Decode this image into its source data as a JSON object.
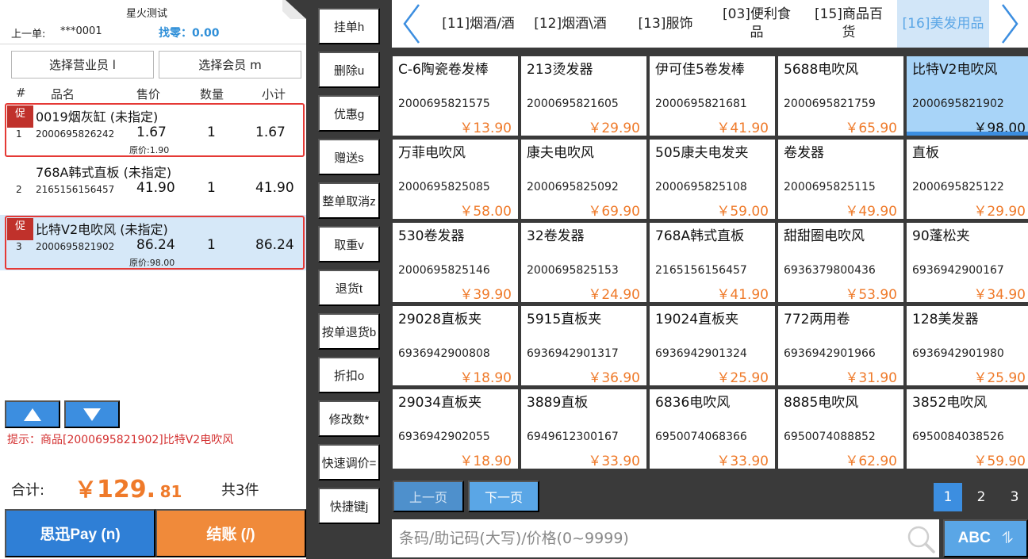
{
  "header": {
    "store_name": "星火测试",
    "last_order_label": "上一单:",
    "last_order_value": "***0001",
    "change_text": "找零：0.00"
  },
  "buttons": {
    "select_clerk": "选择营业员 l",
    "select_member": "选择会员 m"
  },
  "cart": {
    "columns": [
      "#",
      "品名",
      "售价",
      "数量",
      "小计"
    ],
    "promo_label": "促",
    "items": [
      {
        "idx": "1",
        "name": "0019烟灰缸 (未指定)",
        "code": "2000695826242",
        "price": "1.67",
        "qty": "1",
        "subtotal": "1.67",
        "original": "原价:1.90",
        "promo": true
      },
      {
        "idx": "2",
        "name": "768A韩式直板 (未指定)",
        "code": "2165156156457",
        "price": "41.90",
        "qty": "1",
        "subtotal": "41.90",
        "original": "",
        "promo": false
      },
      {
        "idx": "3",
        "name": "比特V2电吹风 (未指定)",
        "code": "2000695821902",
        "price": "86.24",
        "qty": "1",
        "subtotal": "86.24",
        "original": "原价:98.00",
        "promo": true
      }
    ]
  },
  "hint": "提示：商品[2000695821902]比特V2电吹风",
  "total": {
    "label": "合计:",
    "currency": "￥",
    "integer": "129.",
    "decimal": "81",
    "count": "共3件"
  },
  "pay": {
    "sixun": "思迅Pay (n)",
    "checkout": "结账 (/)"
  },
  "toolbar": [
    "挂单h",
    "删除u",
    "优惠g",
    "赠送s",
    "整单取消z",
    "取重v",
    "退货t",
    "按单退货b",
    "折扣o",
    "修改数*",
    "快速调价=",
    "快捷键j"
  ],
  "categories": [
    {
      "label": "[11]烟酒/酒",
      "active": false
    },
    {
      "label": "[12]烟酒\\酒",
      "active": false
    },
    {
      "label": "[13]服饰",
      "active": false
    },
    {
      "label": "[03]便利食品",
      "active": false
    },
    {
      "label": "[15]商品百货",
      "active": false
    },
    {
      "label": "[16]美发用品",
      "active": true
    }
  ],
  "products": [
    {
      "name": "C-6陶瓷卷发棒",
      "code": "2000695821575",
      "price": "￥13.90"
    },
    {
      "name": "213烫发器",
      "code": "2000695821605",
      "price": "￥29.90"
    },
    {
      "name": "伊可佳5卷发棒",
      "code": "2000695821681",
      "price": "￥41.90"
    },
    {
      "name": "5688电吹风",
      "code": "2000695821759",
      "price": "￥65.90"
    },
    {
      "name": "比特V2电吹风",
      "code": "2000695821902",
      "price": "￥98.00",
      "selected": true
    },
    {
      "name": "万菲电吹风",
      "code": "2000695825085",
      "price": "￥58.00"
    },
    {
      "name": "康夫电吹风",
      "code": "2000695825092",
      "price": "￥69.90"
    },
    {
      "name": "505康夫电发夹",
      "code": "2000695825108",
      "price": "￥59.00"
    },
    {
      "name": "卷发器",
      "code": "2000695825115",
      "price": "￥49.90"
    },
    {
      "name": "直板",
      "code": "2000695825122",
      "price": "￥29.90"
    },
    {
      "name": "530卷发器",
      "code": "2000695825146",
      "price": "￥39.90"
    },
    {
      "name": "32卷发器",
      "code": "2000695825153",
      "price": "￥24.90"
    },
    {
      "name": "768A韩式直板",
      "code": "2165156156457",
      "price": "￥41.90"
    },
    {
      "name": "甜甜圈电吹风",
      "code": "6936379800436",
      "price": "￥53.90"
    },
    {
      "name": "90蓬松夹",
      "code": "6936942900167",
      "price": "￥34.90"
    },
    {
      "name": "29028直板夹",
      "code": "6936942900808",
      "price": "￥18.90"
    },
    {
      "name": "5915直板夹",
      "code": "6936942901317",
      "price": "￥36.90"
    },
    {
      "name": "19024直板夹",
      "code": "6936942901324",
      "price": "￥25.90"
    },
    {
      "name": "772两用卷",
      "code": "6936942901966",
      "price": "￥31.90"
    },
    {
      "name": "128美发器",
      "code": "6936942901980",
      "price": "￥25.90"
    },
    {
      "name": "29034直板夹",
      "code": "6936942902055",
      "price": "￥18.90"
    },
    {
      "name": "3889直板",
      "code": "6949612300167",
      "price": "￥33.90"
    },
    {
      "name": "6836电吹风",
      "code": "6950074068366",
      "price": "￥33.90"
    },
    {
      "name": "8885电吹风",
      "code": "6950074088852",
      "price": "￥62.90"
    },
    {
      "name": "3852电吹风",
      "code": "6950084038526",
      "price": "￥59.90"
    }
  ],
  "pager": {
    "prev": "上一页",
    "next": "下一页",
    "pages": [
      "1",
      "2",
      "3"
    ],
    "current": "1"
  },
  "search": {
    "placeholder": "条码/助记码(大写)/价格(0~9999)",
    "value": ""
  },
  "ime_toggle": {
    "label": "ABC",
    "switch_glyph": "⥮"
  },
  "colors": {
    "accent_blue": "#3c8ee0",
    "price_orange": "#ef7a2a",
    "checkout_orange": "#f08a3a",
    "promo_red": "#c0312b",
    "alert_red": "#d32f2f"
  }
}
